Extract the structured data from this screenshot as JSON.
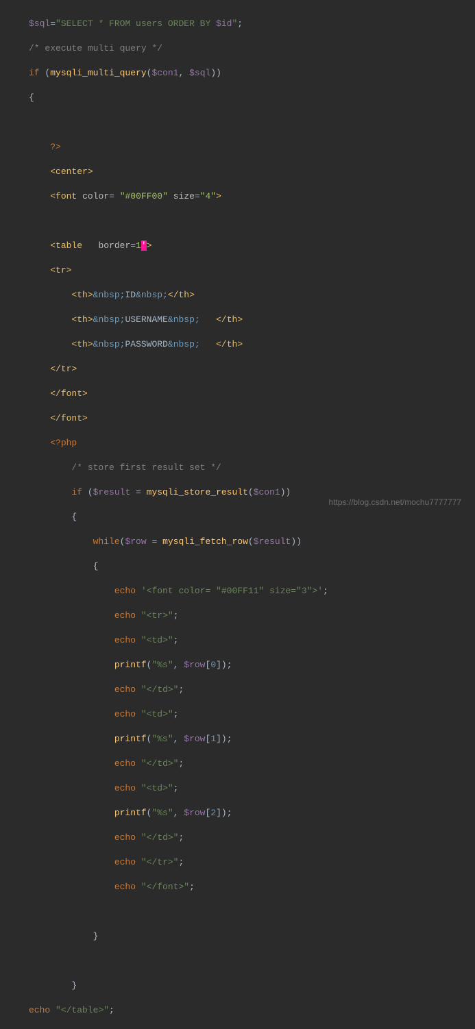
{
  "code": {
    "l1_var": "$sql",
    "l1_op": "=",
    "l1_str1": "\"SELECT * FROM users ORDER BY ",
    "l1_var2": "$id",
    "l1_str2": "\"",
    "l1_end": ";",
    "l2_cmt": "/* execute multi query */",
    "l3_if": "if",
    "l3_fn": "mysqli_multi_query",
    "l3_arg1": "$con1",
    "l3_arg2": "$sql",
    "l4_brace": "{",
    "l6_php": "?>",
    "l7_tag": "center",
    "l8_tag": "font",
    "l8_attr1": "color",
    "l8_val1": "\"#00FF00\"",
    "l8_attr2": "size",
    "l8_val2": "\"4\"",
    "l10_tag": "table",
    "l10_attr": "border",
    "l10_val": "1",
    "l10_hl": "'",
    "l11_tag": "tr",
    "l12_tag": "th",
    "l12_ent": "&nbsp;",
    "l12_txt": "ID",
    "l13_txt": "USERNAME",
    "l14_txt": "PASSWORD",
    "l18_php": "<?php",
    "l19_cmt": "/* store first result set */",
    "l20_if": "if",
    "l20_var": "$result",
    "l20_fn": "mysqli_store_result",
    "l20_arg": "$con1",
    "l22_while": "while",
    "l22_var": "$row",
    "l22_fn": "mysqli_fetch_row",
    "l22_arg": "$result",
    "l24_echo": "echo",
    "l24_str": "'<font color= \"#00FF11\" size=\"3\">'",
    "l25_str": "\"<tr>\"",
    "l26_str": "\"<td>\"",
    "l27_fn": "printf",
    "l27_fmt": "\"%s\"",
    "l27_var": "$row",
    "l27_idx0": "0",
    "l28_str": "\"</td>\"",
    "l30_idx1": "1",
    "l33_idx2": "2",
    "l35_str": "\"</tr>\"",
    "l36_str": "\"</font>\"",
    "l40_str": "\"</table>\""
  },
  "watermark": "https://blog.csdn.net/mochu7777777"
}
